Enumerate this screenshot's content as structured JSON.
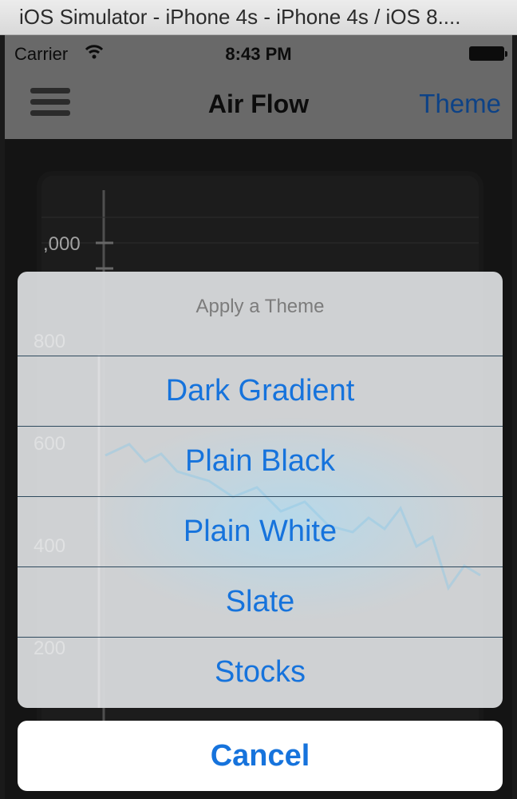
{
  "window": {
    "title": "iOS Simulator - iPhone 4s - iPhone 4s / iOS 8...."
  },
  "status_bar": {
    "carrier": "Carrier",
    "time": "8:43 PM"
  },
  "nav": {
    "title": "Air Flow",
    "theme_button": "Theme"
  },
  "chart": {
    "y_ticks": [
      ",000",
      "800",
      "600",
      "400",
      "200"
    ]
  },
  "action_sheet": {
    "title": "Apply a Theme",
    "options": [
      "Dark Gradient",
      "Plain Black",
      "Plain White",
      "Slate",
      "Stocks"
    ],
    "cancel": "Cancel"
  },
  "colors": {
    "accent": "#1673dc",
    "theme_link": "#1258b3"
  }
}
